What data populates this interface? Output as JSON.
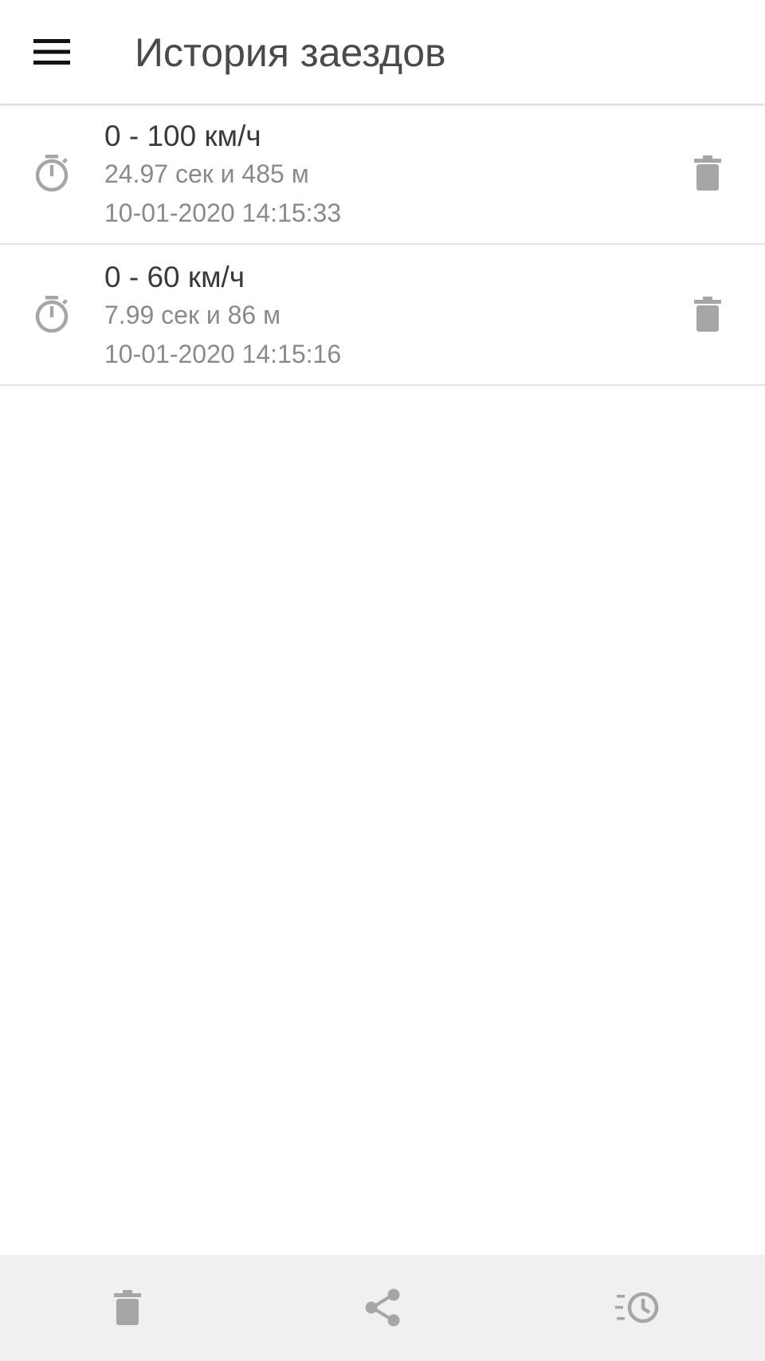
{
  "app_bar": {
    "title": "История заездов",
    "menu_icon": "hamburger-menu-icon"
  },
  "runs": [
    {
      "title": "0 - 100 км/ч",
      "result": "24.97 сек и 485 м",
      "timestamp": "10-01-2020 14:15:33",
      "icon": "stopwatch-icon",
      "delete_icon": "trash-icon"
    },
    {
      "title": "0 - 60 км/ч",
      "result": "7.99 сек и 86 м",
      "timestamp": "10-01-2020 14:15:16",
      "icon": "stopwatch-icon",
      "delete_icon": "trash-icon"
    }
  ],
  "bottom_bar": {
    "actions": [
      {
        "icon": "trash-icon"
      },
      {
        "icon": "share-icon"
      },
      {
        "icon": "history-icon"
      }
    ]
  },
  "colors": {
    "icon_gray": "#a6a6a6",
    "title_text": "#4a4a4a",
    "secondary_text": "#8a8a8a",
    "bottom_bar_bg": "#f0f0f0",
    "divider": "#e3e3e3"
  }
}
